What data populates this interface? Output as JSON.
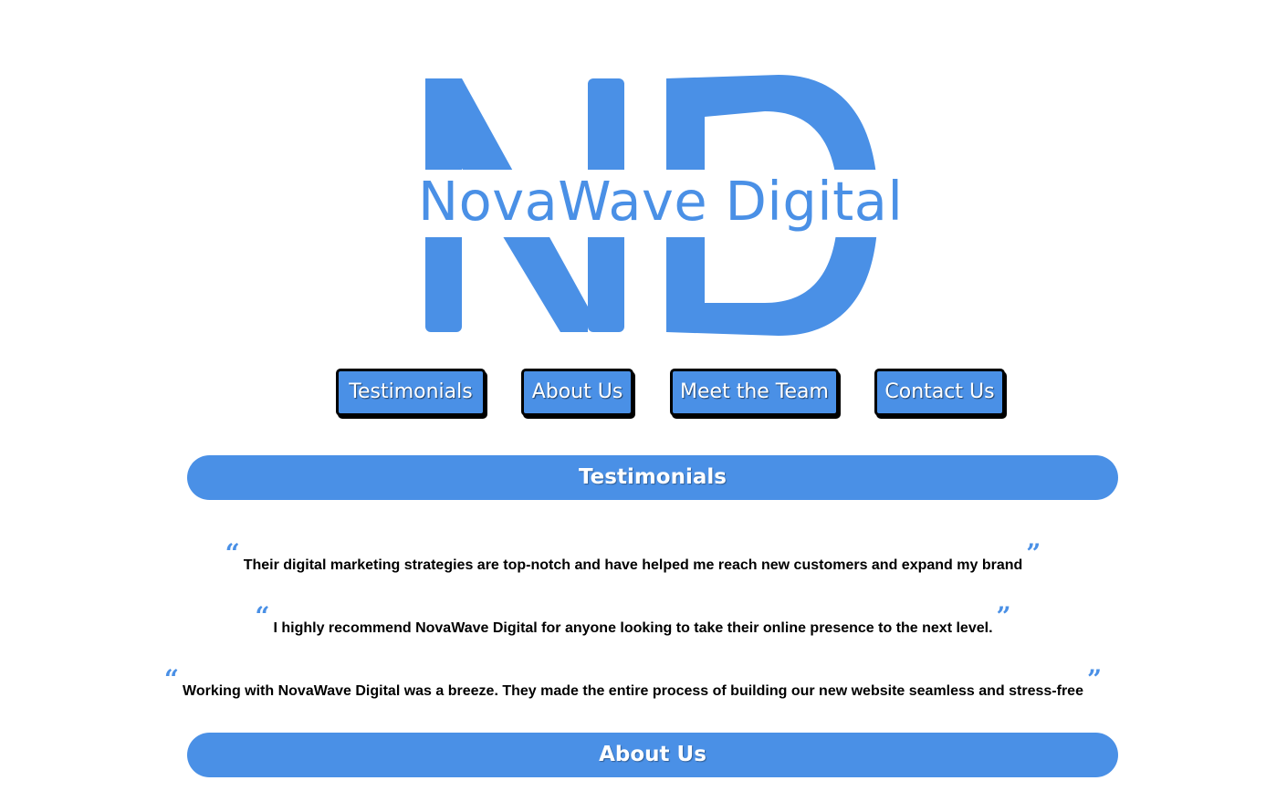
{
  "brand": {
    "monogram": "ND",
    "name": "NovaWave Digital",
    "color": "#4a90e6"
  },
  "nav": {
    "items": [
      {
        "label": "Testimonials"
      },
      {
        "label": "About Us"
      },
      {
        "label": "Meet the Team"
      },
      {
        "label": "Contact Us"
      }
    ]
  },
  "sections": {
    "testimonials_title": "Testimonials",
    "about_title": "About Us"
  },
  "testimonials": {
    "open_mark": "“",
    "close_mark": "”",
    "items": [
      {
        "text": "Their digital marketing strategies are top-notch and have helped me reach new customers and expand my brand"
      },
      {
        "text": "I highly recommend NovaWave Digital for anyone looking to take their online presence to the next level."
      },
      {
        "text": "Working with NovaWave Digital was a breeze. They made the entire process of building our new website seamless and stress-free"
      }
    ]
  }
}
